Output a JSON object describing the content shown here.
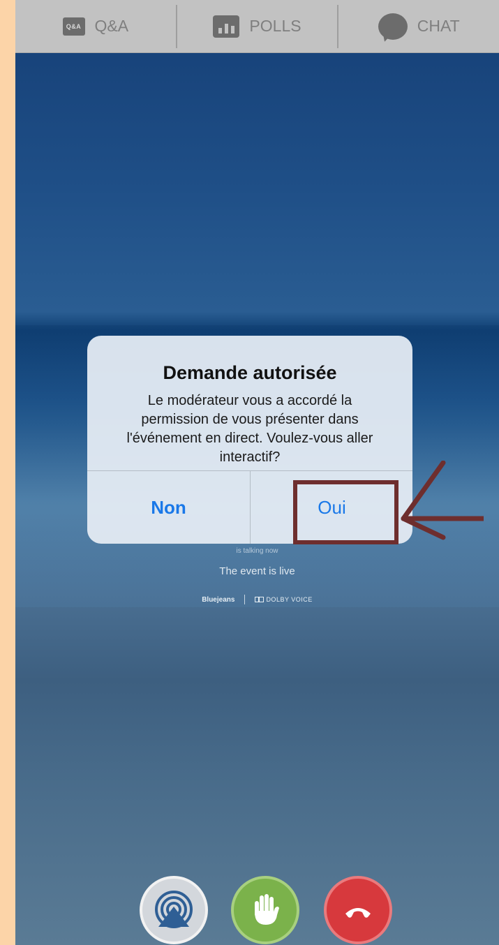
{
  "tabs": [
    {
      "badge": "Q&A",
      "label": "Q&A",
      "icon": "qa-icon"
    },
    {
      "label": "POLLS",
      "icon": "poll-icon"
    },
    {
      "label": "CHAT",
      "icon": "chat-bubble-icon"
    }
  ],
  "event": {
    "talking": "is talking now",
    "status": "The event is live",
    "brand": "Bluejeans",
    "partner": "DOLBY VOICE"
  },
  "dialog": {
    "title": "Demande autorisée",
    "message": "Le modérateur vous a accordé la permission de vous présenter dans l'événement en direct. Voulez-vous aller interactif?",
    "no_label": "Non",
    "yes_label": "Oui"
  },
  "controls": [
    {
      "name": "present",
      "icon": "broadcast-icon",
      "color": "#d3d7dc"
    },
    {
      "name": "raise-hand",
      "icon": "hand-icon",
      "color": "#7bb24b"
    },
    {
      "name": "hang-up",
      "icon": "phone-hangup-icon",
      "color": "#d7393d"
    }
  ],
  "colors": {
    "accent": "#1a78e8",
    "annotation": "#6e2e2e",
    "outer_background": "#fcd4a8"
  }
}
